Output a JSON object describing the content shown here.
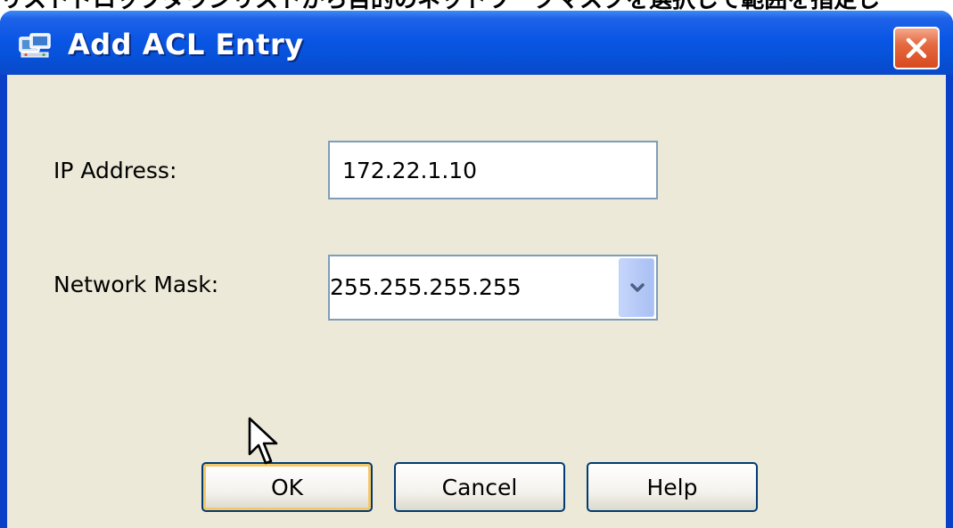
{
  "background_text": "リストドロップダウンリストから目的のネットワークマスクを選択して範囲を指定し",
  "window": {
    "title": "Add ACL Entry",
    "icon": "network-app-icon",
    "close_icon": "close-icon"
  },
  "form": {
    "ip_address_label": "IP Address:",
    "ip_address_value": "172.22.1.10",
    "network_mask_label": "Network Mask:",
    "network_mask_value": "255.255.255.255",
    "dropdown_icon": "chevron-down-icon"
  },
  "buttons": {
    "ok": "OK",
    "cancel": "Cancel",
    "help": "Help"
  },
  "colors": {
    "titlebar": "#0a56e5",
    "client_area": "#ece9d8",
    "close_button": "#d84a1e",
    "button_border": "#003c74",
    "default_button_focus": "#f5c86a"
  }
}
